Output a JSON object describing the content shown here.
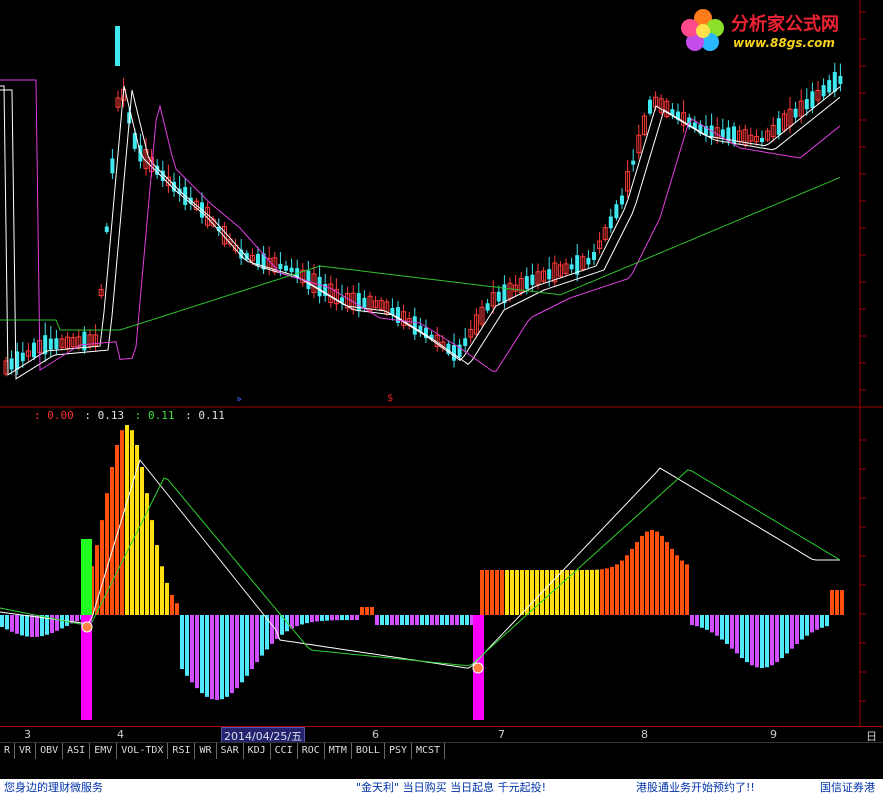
{
  "watermark": {
    "title": "分析家公式网",
    "url": "www.88gs.com"
  },
  "indicator_legend": {
    "v1": ": 0.00",
    "v2": ": 0.13",
    "v3": ": 0.11",
    "v4": ": 0.11",
    "colors": [
      "#ff3030",
      "#e0e0e0",
      "#40e040",
      "#e0e0e0"
    ]
  },
  "x_axis": {
    "labels": [
      "3",
      "4",
      "6",
      "7",
      "8",
      "9"
    ],
    "date_label": "2014/04/25/五",
    "right_label": "日"
  },
  "indicator_tabs": [
    "R",
    "VR",
    "OBV",
    "ASI",
    "EMV",
    "VOL-TDX",
    "RSI",
    "WR",
    "SAR",
    "KDJ",
    "CCI",
    "ROC",
    "MTM",
    "BOLL",
    "PSY",
    "MCST"
  ],
  "ticker": {
    "left": "您身边的理财微服务",
    "middle": "\"金天利\"  当日购买 当日起息 千元起投!",
    "right": "港股通业务开始预约了!!",
    "far_right": "国信证券港"
  },
  "colors": {
    "up": "#ff3a3a",
    "down": "#40e8f0",
    "ma5": "#ffffff",
    "ma10": "#ffffff",
    "ma20": "#e040e0",
    "ma60": "#30c030",
    "bar_red": "#ff5010",
    "bar_yellow": "#ffdf10",
    "bar_cyan": "#50e8ff",
    "bar_magenta": "#d050ff"
  },
  "chart_data": [
    {
      "type": "candlestick",
      "title": "",
      "series": [
        {
          "name": "",
          "values_price_trend": [
            1,
            1.2,
            1.1,
            3.0,
            2.4,
            2.1,
            1.8,
            1.5,
            1.3,
            1.5,
            1.45,
            1.35,
            1.25,
            1.2,
            1.3,
            1.55,
            1.7,
            2.3,
            2.8,
            2.6,
            2.7
          ]
        }
      ]
    },
    {
      "type": "bar",
      "title": "",
      "description_values": {
        "legend_values": [
          0.0,
          0.13,
          0.11,
          0.11
        ]
      }
    }
  ],
  "marker_sign": "$"
}
